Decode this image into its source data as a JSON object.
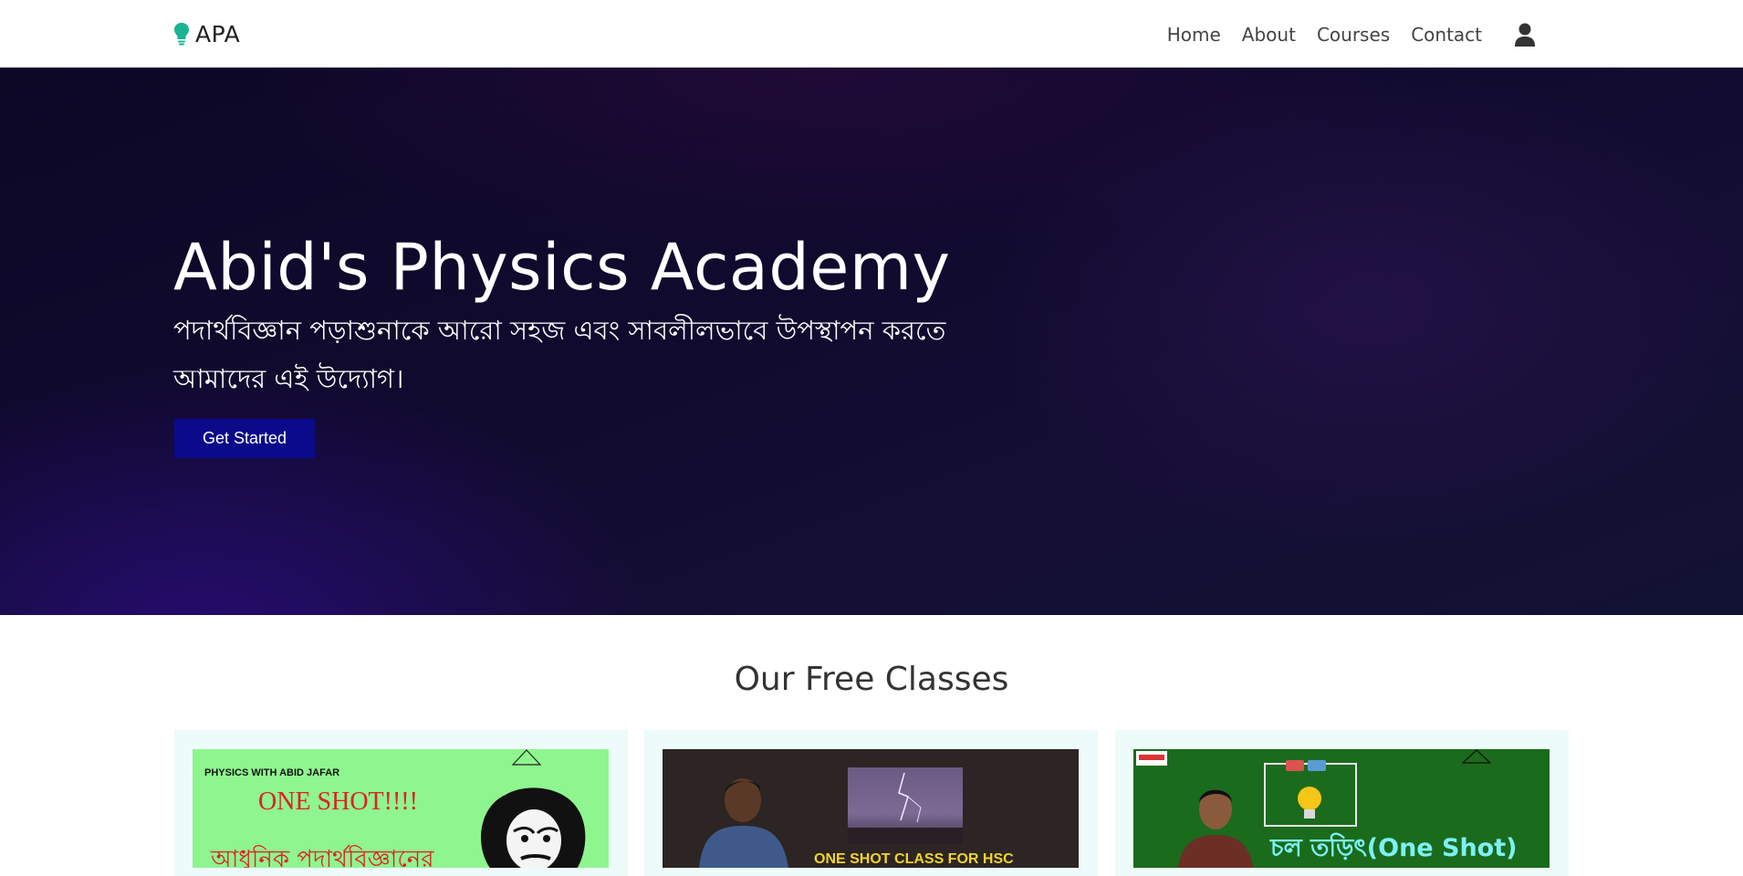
{
  "navbar": {
    "brand": "APA",
    "links": [
      "Home",
      "About",
      "Courses",
      "Contact"
    ]
  },
  "hero": {
    "title": "Abid's Physics Academy",
    "subtitle": "পদার্থবিজ্ঞান পড়াশুনাকে আরো সহজ এবং সাবলীলভাবে উপস্থাপন করতে আমাদের এই উদ্যোগ।",
    "button": "Get Started"
  },
  "free_classes": {
    "title": "Our Free Classes",
    "cards": [
      {
        "thumb_small": "PHYSICS WITH ABID JAFAR",
        "thumb_big": "ONE SHOT!!!!",
        "thumb_bn": "আধুনিক পদার্থবিজ্ঞানের"
      },
      {
        "thumb_text": "ONE SHOT CLASS FOR HSC"
      },
      {
        "thumb_text": "চল তড়িৎ(One Shot)"
      }
    ]
  },
  "colors": {
    "brand_icon": "#19b394",
    "hero_button": "#0a0a8a",
    "card_bg": "#edfbfa"
  },
  "icons": {
    "brand": "lightbulb-icon",
    "user": "user-icon"
  }
}
